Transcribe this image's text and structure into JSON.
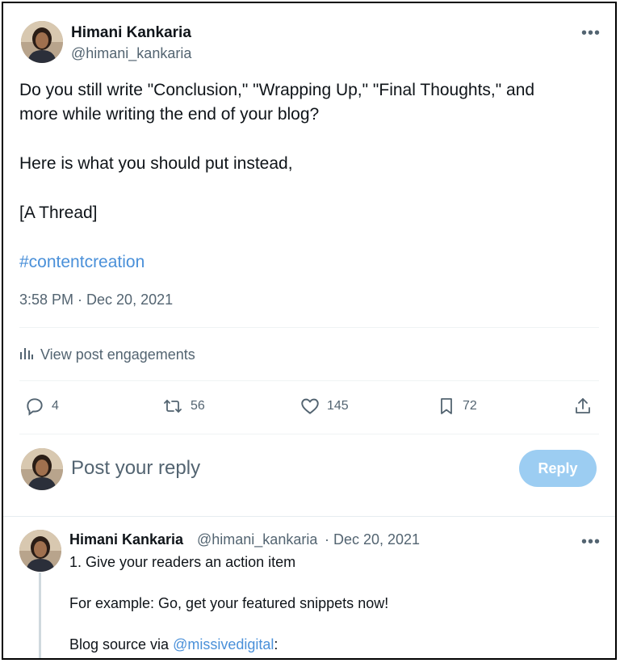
{
  "main_post": {
    "author_name": "Himani Kankaria",
    "author_handle": "@himani_kankaria",
    "more_label": "•••",
    "text_lines": [
      "Do you still write \"Conclusion,\" \"Wrapping Up,\" \"Final Thoughts,\" and",
      "more while writing the end of your blog?",
      "Here is what you should put instead,",
      "[A Thread]"
    ],
    "hashtag": "#contentcreation",
    "timestamp": "3:58 PM · Dec 20, 2021",
    "engagements_label": "View post engagements",
    "actions": {
      "reply_count": "4",
      "repost_count": "56",
      "like_count": "145",
      "bookmark_count": "72"
    }
  },
  "composer": {
    "placeholder": "Post your reply",
    "reply_button": "Reply"
  },
  "reply_post": {
    "author_name": "Himani Kankaria",
    "author_handle": "@himani_kankaria",
    "date": "· Dec 20, 2021",
    "more_label": "•••",
    "line1": "1. Give your readers an action item",
    "line2": "For example: Go, get your featured snippets now!",
    "line3_prefix": "Blog source via ",
    "line3_mention": "@missivedigital",
    "line3_suffix": ":"
  },
  "colors": {
    "link": "#4a90d9",
    "secondary_text": "#536471",
    "reply_button_bg": "#9ccdf2"
  }
}
